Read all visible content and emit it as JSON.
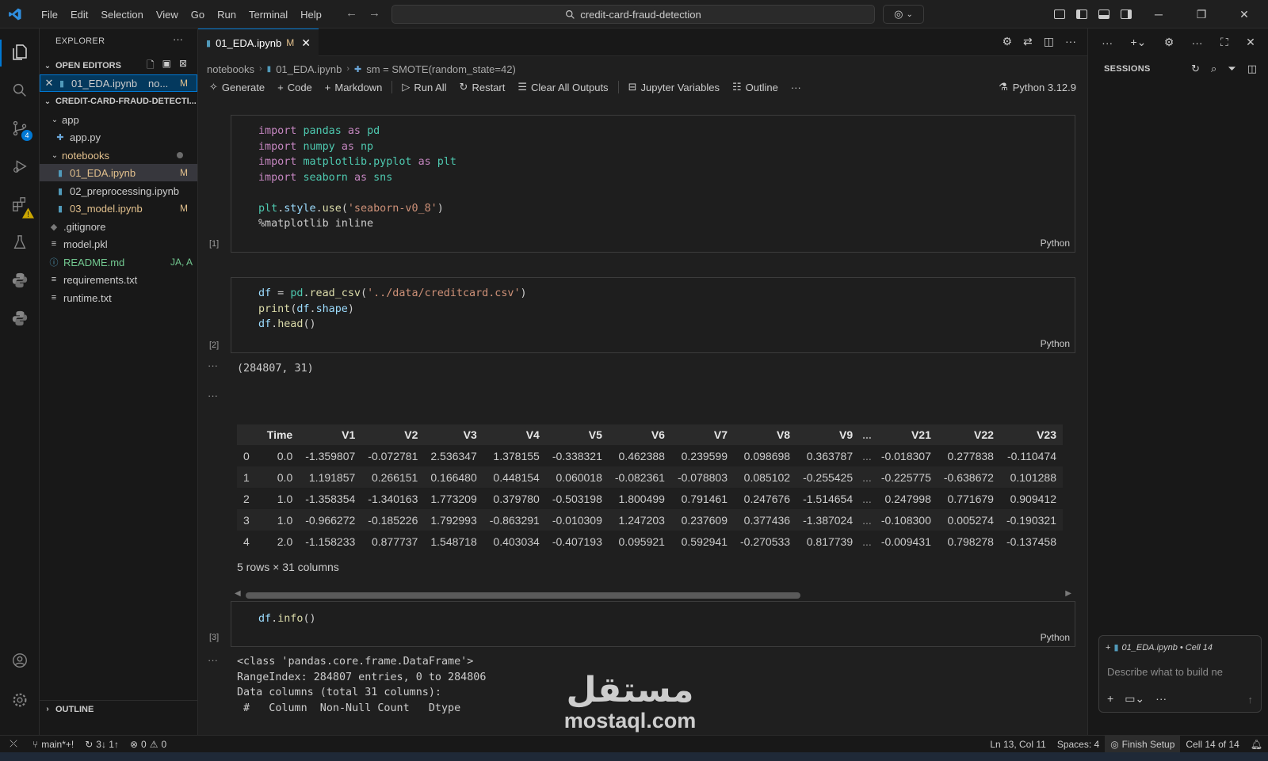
{
  "menu": [
    "File",
    "Edit",
    "Selection",
    "View",
    "Go",
    "Run",
    "Terminal",
    "Help"
  ],
  "command_center": {
    "text": "credit-card-fraud-detection"
  },
  "explorer": {
    "title": "EXPLORER",
    "open_editors": {
      "header": "OPEN EDITORS",
      "items": [
        {
          "name": "01_EDA.ipynb",
          "hint": "no...",
          "decoration": "M"
        }
      ]
    },
    "workspace": {
      "header": "CREDIT-CARD-FRAUD-DETECTI...",
      "tree": [
        {
          "name": "app",
          "type": "folder",
          "depth": 0
        },
        {
          "name": "app.py",
          "type": "python",
          "depth": 1
        },
        {
          "name": "notebooks",
          "type": "folder",
          "depth": 0
        },
        {
          "name": "01_EDA.ipynb",
          "type": "notebook",
          "depth": 1,
          "decoration": "M"
        },
        {
          "name": "02_preprocessing.ipynb",
          "type": "notebook",
          "depth": 1
        },
        {
          "name": "03_model.ipynb",
          "type": "notebook",
          "depth": 1,
          "decoration": "M"
        },
        {
          "name": ".gitignore",
          "type": "git",
          "depth": 0
        },
        {
          "name": "model.pkl",
          "type": "file",
          "depth": 0
        },
        {
          "name": "README.md",
          "type": "info",
          "depth": 0,
          "decoration": "JA, A"
        },
        {
          "name": "requirements.txt",
          "type": "file",
          "depth": 0
        },
        {
          "name": "runtime.txt",
          "type": "file",
          "depth": 0
        }
      ]
    },
    "outline_header": "OUTLINE"
  },
  "activity": {
    "scm_badge": "4"
  },
  "editor": {
    "tab": {
      "title": "01_EDA.ipynb",
      "modified": "M"
    },
    "breadcrumb": [
      "notebooks",
      "01_EDA.ipynb",
      "sm = SMOTE(random_state=42)"
    ],
    "toolbar": [
      "Generate",
      "Code",
      "Markdown",
      "Run All",
      "Restart",
      "Clear All Outputs",
      "Jupyter Variables",
      "Outline"
    ],
    "kernel": "Python 3.12.9",
    "cells": [
      {
        "exec": "[1]",
        "lang": "Python"
      },
      {
        "exec": "[2]",
        "lang": "Python"
      },
      {
        "exec": "[3]",
        "lang": "Python"
      }
    ],
    "outputs": {
      "shape": "(284807, 31)",
      "table": {
        "columns": [
          "",
          "Time",
          "V1",
          "V2",
          "V3",
          "V4",
          "V5",
          "V6",
          "V7",
          "V8",
          "V9",
          "...",
          "V21",
          "V22",
          "V23"
        ],
        "rows": [
          [
            "0",
            "0.0",
            "-1.359807",
            "-0.072781",
            "2.536347",
            "1.378155",
            "-0.338321",
            "0.462388",
            "0.239599",
            "0.098698",
            "0.363787",
            "...",
            "-0.018307",
            "0.277838",
            "-0.110474"
          ],
          [
            "1",
            "0.0",
            "1.191857",
            "0.266151",
            "0.166480",
            "0.448154",
            "0.060018",
            "-0.082361",
            "-0.078803",
            "0.085102",
            "-0.255425",
            "...",
            "-0.225775",
            "-0.638672",
            "0.101288"
          ],
          [
            "2",
            "1.0",
            "-1.358354",
            "-1.340163",
            "1.773209",
            "0.379780",
            "-0.503198",
            "1.800499",
            "0.791461",
            "0.247676",
            "-1.514654",
            "...",
            "0.247998",
            "0.771679",
            "0.909412"
          ],
          [
            "3",
            "1.0",
            "-0.966272",
            "-0.185226",
            "1.792993",
            "-0.863291",
            "-0.010309",
            "1.247203",
            "0.237609",
            "0.377436",
            "-1.387024",
            "...",
            "-0.108300",
            "0.005274",
            "-0.190321"
          ],
          [
            "4",
            "2.0",
            "-1.158233",
            "0.877737",
            "1.548718",
            "0.403034",
            "-0.407193",
            "0.095921",
            "0.592941",
            "-0.270533",
            "0.817739",
            "...",
            "-0.009431",
            "0.798278",
            "-0.137458"
          ]
        ],
        "note": "5 rows × 31 columns"
      },
      "info_lines": [
        "<class 'pandas.core.frame.DataFrame'>",
        "RangeIndex: 284807 entries, 0 to 284806",
        "Data columns (total 31 columns):",
        " #   Column  Non-Null Count   Dtype"
      ]
    }
  },
  "chat": {
    "sessions_header": "SESSIONS",
    "context": "01_EDA.ipynb • Cell 14",
    "placeholder": "Describe what to build ne"
  },
  "status": {
    "branch": "main*+!",
    "sync": "3↓ 1↑",
    "errors": "0",
    "warnings": "0",
    "position": "Ln 13, Col 11",
    "spaces": "Spaces: 4",
    "finish_setup": "Finish Setup",
    "cell": "Cell 14 of 14"
  },
  "watermark": {
    "arabic": "مستقل",
    "latin": "mostaql.com"
  }
}
